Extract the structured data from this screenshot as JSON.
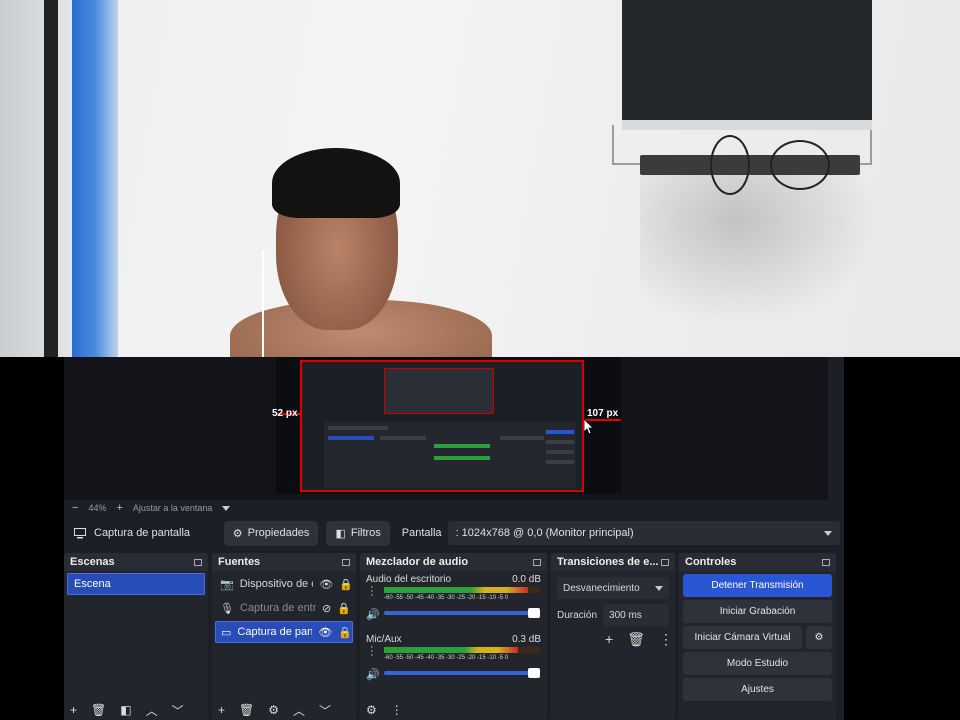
{
  "preview": {
    "left_px": "52 px",
    "right_px": "107 px",
    "zoom": "44%",
    "fit_label": "Ajustar a la ventana"
  },
  "source_bar": {
    "source_name": "Captura de pantalla",
    "properties_label": "Propiedades",
    "filters_label": "Filtros",
    "display_label": "Pantalla",
    "display_value": ": 1024x768 @ 0,0 (Monitor principal)"
  },
  "scenes": {
    "title": "Escenas",
    "items": [
      "Escena"
    ]
  },
  "sources": {
    "title": "Fuentes",
    "items": [
      {
        "label": "Dispositivo de ca",
        "icon": "camera-icon"
      },
      {
        "label": "Captura de entra",
        "icon": "microphone-icon"
      },
      {
        "label": "Captura de pant",
        "icon": "monitor-icon"
      }
    ]
  },
  "mixer": {
    "title": "Mezclador de audio",
    "channels": [
      {
        "name": "Audio del escritorio",
        "db": "0.0 dB",
        "level": 0.92
      },
      {
        "name": "Mic/Aux",
        "db": "0.3 dB",
        "level": 0.86
      }
    ],
    "scale": "-60 -55 -50 -45 -40 -35 -30 -25 -20 -15 -10 -5 0"
  },
  "transitions": {
    "title": "Transiciones de e...",
    "selected": "Desvanecimiento",
    "duration_label": "Duración",
    "duration_value": "300 ms"
  },
  "controls": {
    "title": "Controles",
    "stop_stream": "Detener Transmisión",
    "start_record": "Iniciar Grabación",
    "virtual_cam": "Iniciar Cámara Virtual",
    "studio_mode": "Modo Estudio",
    "settings": "Ajustes"
  },
  "colors": {
    "accent": "#2a56d6",
    "selection": "#284cb8",
    "panel": "#23252d",
    "bounds": "#e00000"
  }
}
